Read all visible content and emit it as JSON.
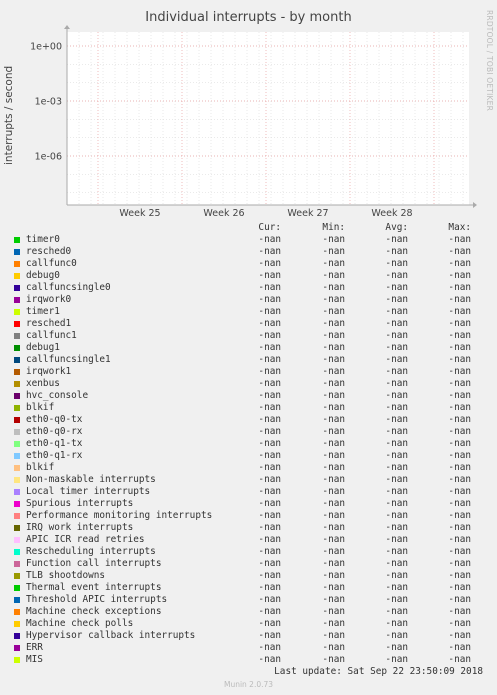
{
  "chart_data": {
    "type": "line",
    "title": "Individual interrupts - by month",
    "ylabel": "interrupts / second",
    "y_scale": "log",
    "y_ticks": [
      {
        "value": 1,
        "label": "1e+00"
      },
      {
        "value": 0.001,
        "label": "1e-03"
      },
      {
        "value": 1e-06,
        "label": "1e-06"
      }
    ],
    "x_ticks": [
      "Week 25",
      "Week 26",
      "Week 27",
      "Week 28"
    ],
    "grid": true,
    "columns": [
      "Cur:",
      "Min:",
      "Avg:",
      "Max:"
    ],
    "series": [
      {
        "name": "timer0",
        "color": "#00cc00",
        "cur": "-nan",
        "min": "-nan",
        "avg": "-nan",
        "max": "-nan"
      },
      {
        "name": "resched0",
        "color": "#0066b3",
        "cur": "-nan",
        "min": "-nan",
        "avg": "-nan",
        "max": "-nan"
      },
      {
        "name": "callfunc0",
        "color": "#ff8000",
        "cur": "-nan",
        "min": "-nan",
        "avg": "-nan",
        "max": "-nan"
      },
      {
        "name": "debug0",
        "color": "#ffcc00",
        "cur": "-nan",
        "min": "-nan",
        "avg": "-nan",
        "max": "-nan"
      },
      {
        "name": "callfuncsingle0",
        "color": "#330099",
        "cur": "-nan",
        "min": "-nan",
        "avg": "-nan",
        "max": "-nan"
      },
      {
        "name": "irqwork0",
        "color": "#990099",
        "cur": "-nan",
        "min": "-nan",
        "avg": "-nan",
        "max": "-nan"
      },
      {
        "name": "timer1",
        "color": "#ccff00",
        "cur": "-nan",
        "min": "-nan",
        "avg": "-nan",
        "max": "-nan"
      },
      {
        "name": "resched1",
        "color": "#ff0000",
        "cur": "-nan",
        "min": "-nan",
        "avg": "-nan",
        "max": "-nan"
      },
      {
        "name": "callfunc1",
        "color": "#808080",
        "cur": "-nan",
        "min": "-nan",
        "avg": "-nan",
        "max": "-nan"
      },
      {
        "name": "debug1",
        "color": "#008f00",
        "cur": "-nan",
        "min": "-nan",
        "avg": "-nan",
        "max": "-nan"
      },
      {
        "name": "callfuncsingle1",
        "color": "#00487d",
        "cur": "-nan",
        "min": "-nan",
        "avg": "-nan",
        "max": "-nan"
      },
      {
        "name": "irqwork1",
        "color": "#b35a00",
        "cur": "-nan",
        "min": "-nan",
        "avg": "-nan",
        "max": "-nan"
      },
      {
        "name": "xenbus",
        "color": "#b38f00",
        "cur": "-nan",
        "min": "-nan",
        "avg": "-nan",
        "max": "-nan"
      },
      {
        "name": "hvc_console",
        "color": "#6b006b",
        "cur": "-nan",
        "min": "-nan",
        "avg": "-nan",
        "max": "-nan"
      },
      {
        "name": "blkif",
        "color": "#8fb300",
        "cur": "-nan",
        "min": "-nan",
        "avg": "-nan",
        "max": "-nan"
      },
      {
        "name": "eth0-q0-tx",
        "color": "#b30000",
        "cur": "-nan",
        "min": "-nan",
        "avg": "-nan",
        "max": "-nan"
      },
      {
        "name": "eth0-q0-rx",
        "color": "#bebebe",
        "cur": "-nan",
        "min": "-nan",
        "avg": "-nan",
        "max": "-nan"
      },
      {
        "name": "eth0-q1-tx",
        "color": "#80ff80",
        "cur": "-nan",
        "min": "-nan",
        "avg": "-nan",
        "max": "-nan"
      },
      {
        "name": "eth0-q1-rx",
        "color": "#80c9ff",
        "cur": "-nan",
        "min": "-nan",
        "avg": "-nan",
        "max": "-nan"
      },
      {
        "name": "blkif",
        "color": "#ffc080",
        "cur": "-nan",
        "min": "-nan",
        "avg": "-nan",
        "max": "-nan"
      },
      {
        "name": "Non-maskable interrupts",
        "color": "#ffe680",
        "cur": "-nan",
        "min": "-nan",
        "avg": "-nan",
        "max": "-nan"
      },
      {
        "name": "Local timer interrupts",
        "color": "#aa80ff",
        "cur": "-nan",
        "min": "-nan",
        "avg": "-nan",
        "max": "-nan"
      },
      {
        "name": "Spurious interrupts",
        "color": "#ee00cc",
        "cur": "-nan",
        "min": "-nan",
        "avg": "-nan",
        "max": "-nan"
      },
      {
        "name": "Performance monitoring interrupts",
        "color": "#ff8080",
        "cur": "-nan",
        "min": "-nan",
        "avg": "-nan",
        "max": "-nan"
      },
      {
        "name": "IRQ work interrupts",
        "color": "#666600",
        "cur": "-nan",
        "min": "-nan",
        "avg": "-nan",
        "max": "-nan"
      },
      {
        "name": "APIC ICR read retries",
        "color": "#ffbfff",
        "cur": "-nan",
        "min": "-nan",
        "avg": "-nan",
        "max": "-nan"
      },
      {
        "name": "Rescheduling interrupts",
        "color": "#00ffcc",
        "cur": "-nan",
        "min": "-nan",
        "avg": "-nan",
        "max": "-nan"
      },
      {
        "name": "Function call interrupts",
        "color": "#cc6699",
        "cur": "-nan",
        "min": "-nan",
        "avg": "-nan",
        "max": "-nan"
      },
      {
        "name": "TLB shootdowns",
        "color": "#999900",
        "cur": "-nan",
        "min": "-nan",
        "avg": "-nan",
        "max": "-nan"
      },
      {
        "name": "Thermal event interrupts",
        "color": "#00cc00",
        "cur": "-nan",
        "min": "-nan",
        "avg": "-nan",
        "max": "-nan"
      },
      {
        "name": "Threshold APIC interrupts",
        "color": "#0066b3",
        "cur": "-nan",
        "min": "-nan",
        "avg": "-nan",
        "max": "-nan"
      },
      {
        "name": "Machine check exceptions",
        "color": "#ff8000",
        "cur": "-nan",
        "min": "-nan",
        "avg": "-nan",
        "max": "-nan"
      },
      {
        "name": "Machine check polls",
        "color": "#ffcc00",
        "cur": "-nan",
        "min": "-nan",
        "avg": "-nan",
        "max": "-nan"
      },
      {
        "name": "Hypervisor callback interrupts",
        "color": "#330099",
        "cur": "-nan",
        "min": "-nan",
        "avg": "-nan",
        "max": "-nan"
      },
      {
        "name": "ERR",
        "color": "#990099",
        "cur": "-nan",
        "min": "-nan",
        "avg": "-nan",
        "max": "-nan"
      },
      {
        "name": "MIS",
        "color": "#ccff00",
        "cur": "-nan",
        "min": "-nan",
        "avg": "-nan",
        "max": "-nan"
      }
    ]
  },
  "side_label": "RRDTOOL / TOBI OETIKER",
  "footer": "Last update: Sat Sep 22 23:50:09 2018",
  "munin_version": "Munin 2.0.73"
}
